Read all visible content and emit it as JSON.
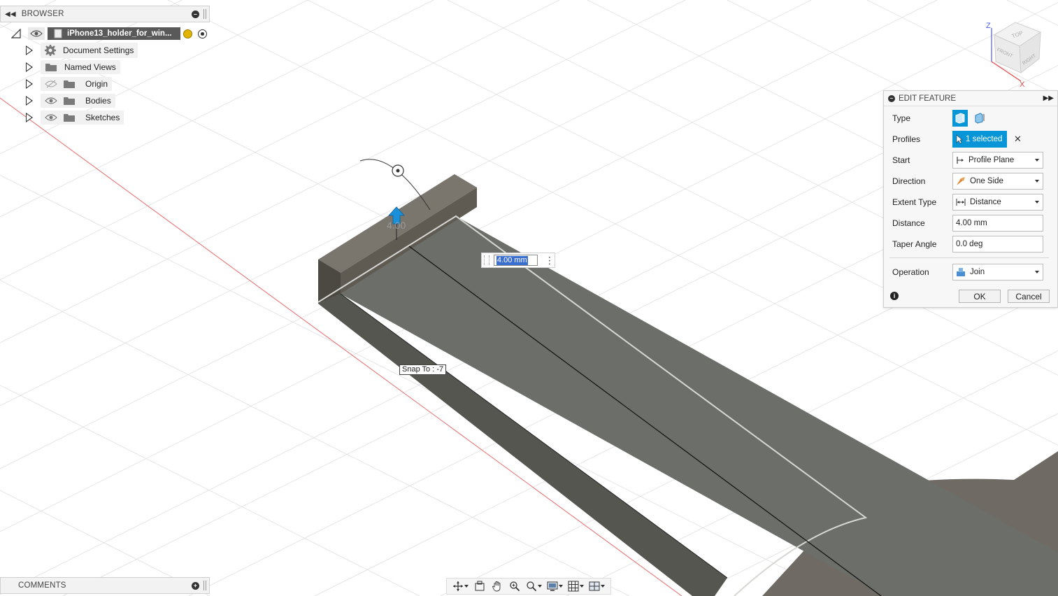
{
  "browser": {
    "title": "BROWSER",
    "root": {
      "label": "iPhone13_holder_for_win..."
    },
    "items": [
      {
        "label": "Document Settings",
        "icon": "gear-icon"
      },
      {
        "label": "Named Views",
        "icon": "folder-icon"
      },
      {
        "label": "Origin",
        "icon": "folder-icon",
        "visible": false
      },
      {
        "label": "Bodies",
        "icon": "folder-icon",
        "visible": true
      },
      {
        "label": "Sketches",
        "icon": "folder-icon",
        "visible": true
      }
    ]
  },
  "comments": {
    "title": "COMMENTS"
  },
  "viewcube": {
    "top": "TOP",
    "front": "FRONT",
    "right": "RIGHT",
    "axis_z": "Z",
    "axis_x": "X"
  },
  "edit_feature": {
    "title": "EDIT FEATURE",
    "type_label": "Type",
    "profiles_label": "Profiles",
    "profiles_value": "1 selected",
    "start_label": "Start",
    "start_value": "Profile Plane",
    "direction_label": "Direction",
    "direction_value": "One Side",
    "extent_type_label": "Extent Type",
    "extent_type_value": "Distance",
    "distance_label": "Distance",
    "distance_value": "4.00 mm",
    "taper_label": "Taper Angle",
    "taper_value": "0.0 deg",
    "operation_label": "Operation",
    "operation_value": "Join",
    "ok_label": "OK",
    "cancel_label": "Cancel"
  },
  "canvas": {
    "dimension_text": "4.00",
    "distance_input": "4.00 mm",
    "snap_tooltip": "Snap To : -7"
  },
  "colors": {
    "accent": "#0696d7",
    "model_dark": "#5f605a",
    "model_face": "#6b6d68",
    "grid": "#d9d9d9",
    "axis_red": "#e84a4a"
  }
}
